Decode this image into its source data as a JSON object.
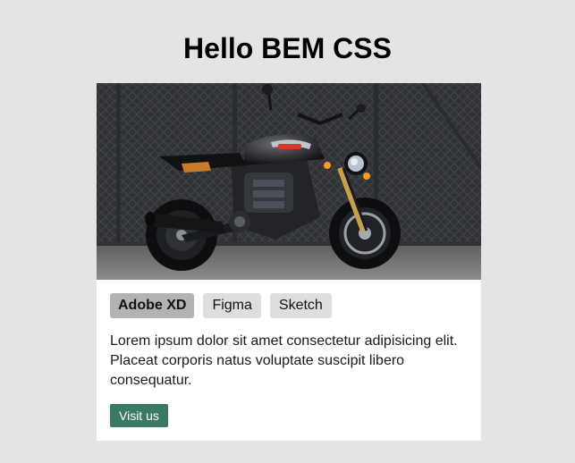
{
  "page": {
    "title": "Hello BEM CSS"
  },
  "card": {
    "image_subject": "black motorcycle in front of chain-link fence",
    "tags": [
      {
        "label": "Adobe XD",
        "active": true
      },
      {
        "label": "Figma",
        "active": false
      },
      {
        "label": "Sketch",
        "active": false
      }
    ],
    "text": "Lorem ipsum dolor sit amet consectetur adipisicing elit. Placeat corporis natus voluptate suscipit libero consequatur.",
    "button_label": "Visit us"
  },
  "colors": {
    "background": "#e4e4e4",
    "card": "#ffffff",
    "tag_active": "#b3b3b3",
    "tag": "#dedede",
    "button": "#3a7a63"
  }
}
